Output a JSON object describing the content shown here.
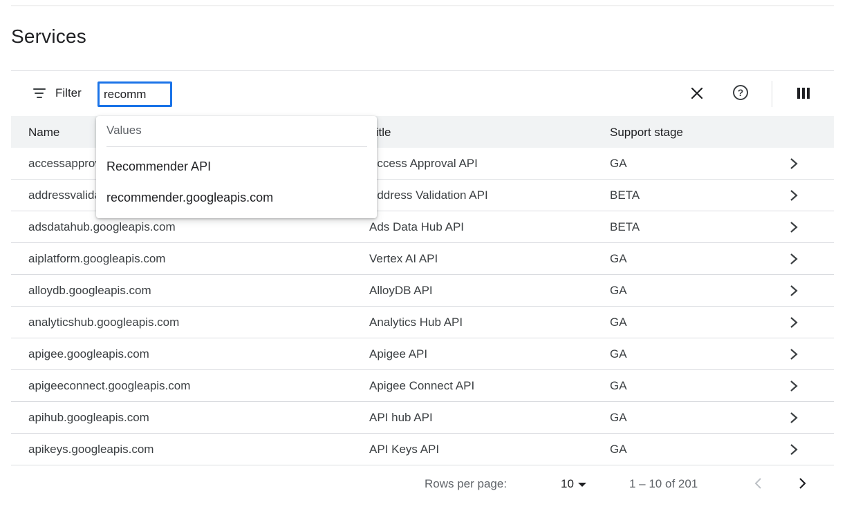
{
  "page": {
    "title": "Services"
  },
  "filter": {
    "label": "Filter",
    "value": "recomm",
    "clear_icon": "close-icon",
    "help_icon": "help-icon",
    "columns_icon": "column-display-icon"
  },
  "table": {
    "columns": [
      "Name",
      "Title",
      "Support stage"
    ],
    "rows": [
      {
        "name": "accessapproval.googleapis.com",
        "title": "Access Approval API",
        "stage": "GA"
      },
      {
        "name": "addressvalidation.googleapis.com",
        "title": "Address Validation API",
        "stage": "BETA"
      },
      {
        "name": "adsdatahub.googleapis.com",
        "title": "Ads Data Hub API",
        "stage": "BETA"
      },
      {
        "name": "aiplatform.googleapis.com",
        "title": "Vertex AI API",
        "stage": "GA"
      },
      {
        "name": "alloydb.googleapis.com",
        "title": "AlloyDB API",
        "stage": "GA"
      },
      {
        "name": "analyticshub.googleapis.com",
        "title": "Analytics Hub API",
        "stage": "GA"
      },
      {
        "name": "apigee.googleapis.com",
        "title": "Apigee API",
        "stage": "GA"
      },
      {
        "name": "apigeeconnect.googleapis.com",
        "title": "Apigee Connect API",
        "stage": "GA"
      },
      {
        "name": "apihub.googleapis.com",
        "title": "API hub API",
        "stage": "GA"
      },
      {
        "name": "apikeys.googleapis.com",
        "title": "API Keys API",
        "stage": "GA"
      }
    ]
  },
  "dropdown": {
    "header": "Values",
    "items": [
      {
        "match": "Recomm",
        "rest": "ender API"
      },
      {
        "match": "recomm",
        "rest": "ender.googleapis.com"
      }
    ]
  },
  "pagination": {
    "rows_per_page_label": "Rows per page:",
    "rows_per_page_value": "10",
    "range": "1 – 10 of 201"
  },
  "colors": {
    "accent": "#1a73e8",
    "header_bg": "#f1f3f4",
    "divider": "#dadce0"
  }
}
